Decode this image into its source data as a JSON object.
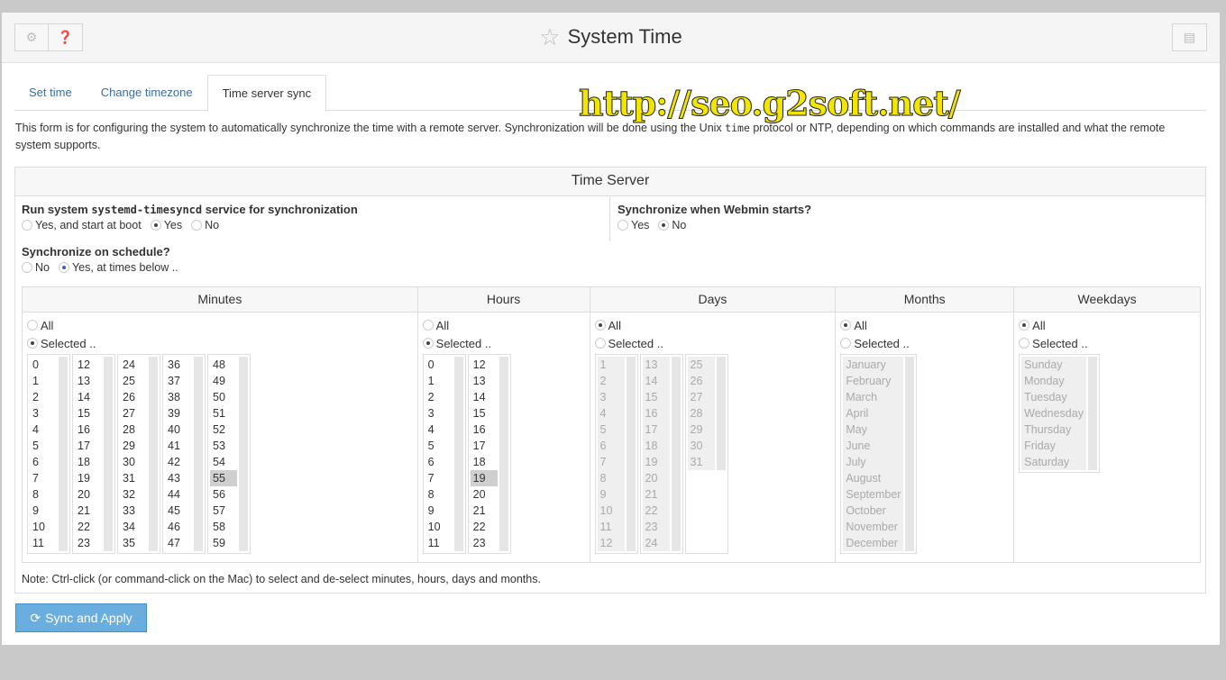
{
  "header": {
    "title": "System Time",
    "icons": [
      "gear-icon",
      "help-icon"
    ],
    "right_icon": "book-icon"
  },
  "watermark": "http://seo.g2soft.net/",
  "tabs": [
    {
      "label": "Set time"
    },
    {
      "label": "Change timezone"
    },
    {
      "label": "Time server sync",
      "active": true
    }
  ],
  "description": {
    "before": "This form is for configuring the system to automatically synchronize the time with a remote server. Synchronization will be done using the Unix ",
    "code": "time",
    "after": " protocol or NTP, depending on which commands are installed and what the remote system supports."
  },
  "section_title": "Time Server",
  "run_service": {
    "label_before": "Run system ",
    "label_code": "systemd-timesyncd",
    "label_after": " service for synchronization",
    "options": [
      "Yes, and start at boot",
      "Yes",
      "No"
    ],
    "selected": "Yes"
  },
  "sync_start": {
    "label": "Synchronize when Webmin starts?",
    "options": [
      "Yes",
      "No"
    ],
    "selected": "No"
  },
  "schedule": {
    "label": "Synchronize on schedule?",
    "options": [
      "No",
      "Yes, at times below .."
    ],
    "selected": "Yes, at times below .."
  },
  "columns": [
    {
      "title": "Minutes",
      "all": "All",
      "selected_label": "Selected ..",
      "mode": "selected",
      "lists": [
        [
          "0",
          "1",
          "2",
          "3",
          "4",
          "5",
          "6",
          "7",
          "8",
          "9",
          "10",
          "11"
        ],
        [
          "12",
          "13",
          "14",
          "15",
          "16",
          "17",
          "18",
          "19",
          "20",
          "21",
          "22",
          "23"
        ],
        [
          "24",
          "25",
          "26",
          "27",
          "28",
          "29",
          "30",
          "31",
          "32",
          "33",
          "34",
          "35"
        ],
        [
          "36",
          "37",
          "38",
          "39",
          "40",
          "41",
          "42",
          "43",
          "44",
          "45",
          "46",
          "47"
        ],
        [
          "48",
          "49",
          "50",
          "51",
          "52",
          "53",
          "54",
          "55",
          "56",
          "57",
          "58",
          "59"
        ]
      ],
      "selected_values": [
        "55"
      ]
    },
    {
      "title": "Hours",
      "all": "All",
      "selected_label": "Selected ..",
      "mode": "selected",
      "lists": [
        [
          "0",
          "1",
          "2",
          "3",
          "4",
          "5",
          "6",
          "7",
          "8",
          "9",
          "10",
          "11"
        ],
        [
          "12",
          "13",
          "14",
          "15",
          "16",
          "17",
          "18",
          "19",
          "20",
          "21",
          "22",
          "23"
        ]
      ],
      "selected_values": [
        "19"
      ]
    },
    {
      "title": "Days",
      "all": "All",
      "selected_label": "Selected ..",
      "mode": "all",
      "lists": [
        [
          "1",
          "2",
          "3",
          "4",
          "5",
          "6",
          "7",
          "8",
          "9",
          "10",
          "11",
          "12"
        ],
        [
          "13",
          "14",
          "15",
          "16",
          "17",
          "18",
          "19",
          "20",
          "21",
          "22",
          "23",
          "24"
        ],
        [
          "25",
          "26",
          "27",
          "28",
          "29",
          "30",
          "31"
        ]
      ],
      "selected_values": []
    },
    {
      "title": "Months",
      "all": "All",
      "selected_label": "Selected ..",
      "mode": "all",
      "lists": [
        [
          "January",
          "February",
          "March",
          "April",
          "May",
          "June",
          "July",
          "August",
          "September",
          "October",
          "November",
          "December"
        ]
      ],
      "selected_values": []
    },
    {
      "title": "Weekdays",
      "all": "All",
      "selected_label": "Selected ..",
      "mode": "all",
      "lists": [
        [
          "Sunday",
          "Monday",
          "Tuesday",
          "Wednesday",
          "Thursday",
          "Friday",
          "Saturday"
        ]
      ],
      "selected_values": []
    }
  ],
  "note": "Note: Ctrl-click (or command-click on the Mac) to select and de-select minutes, hours, days and months.",
  "sync_button": {
    "label": "Sync and Apply",
    "icon": "refresh-icon"
  },
  "colors": {
    "primary_button": "#6aaee0",
    "tab_link": "#3a6e9e"
  }
}
